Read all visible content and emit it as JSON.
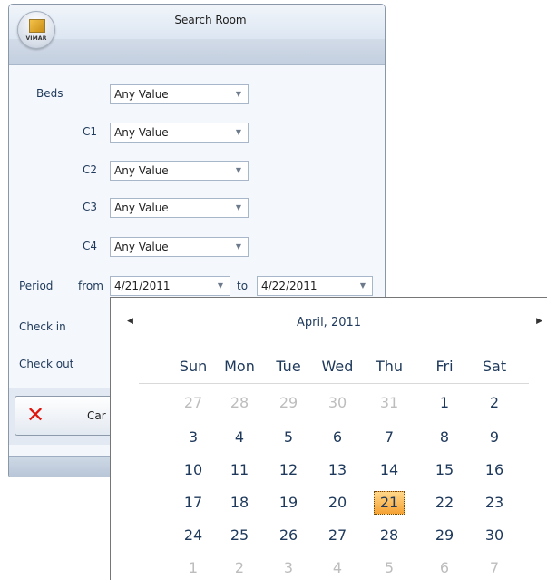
{
  "window": {
    "title": "Search Room",
    "logo_text": "VIMAR"
  },
  "form": {
    "beds_label": "Beds",
    "c1_label": "C1",
    "c2_label": "C2",
    "c3_label": "C3",
    "c4_label": "C4",
    "beds_value": "Any Value",
    "c1_value": "Any Value",
    "c2_value": "Any Value",
    "c3_value": "Any Value",
    "c4_value": "Any Value",
    "period_label": "Period",
    "from_label": "from",
    "to_label": "to",
    "from_value": "4/21/2011",
    "to_value": "4/22/2011",
    "checkin_label": "Check in",
    "checkout_label": "Check out"
  },
  "buttons": {
    "cancel_label": "Car"
  },
  "calendar": {
    "month_label": "April, 2011",
    "weekdays": [
      "Sun",
      "Mon",
      "Tue",
      "Wed",
      "Thu",
      "Fri",
      "Sat"
    ],
    "weeks": [
      [
        "27",
        "28",
        "29",
        "30",
        "31",
        "1",
        "2"
      ],
      [
        "3",
        "4",
        "5",
        "6",
        "7",
        "8",
        "9"
      ],
      [
        "10",
        "11",
        "12",
        "13",
        "14",
        "15",
        "16"
      ],
      [
        "17",
        "18",
        "19",
        "20",
        "21",
        "22",
        "23"
      ],
      [
        "24",
        "25",
        "26",
        "27",
        "28",
        "29",
        "30"
      ],
      [
        "1",
        "2",
        "3",
        "4",
        "5",
        "6",
        "7"
      ]
    ],
    "selected_day": "21"
  },
  "colors": {
    "accent": "#1e395b",
    "selected_day": "#f5a233",
    "cancel_icon": "#e0160e"
  },
  "icons": {
    "prev": "triangle-left-icon",
    "next": "triangle-right-icon",
    "cancel": "red-x-icon",
    "dropdown": "chevron-down-icon"
  }
}
